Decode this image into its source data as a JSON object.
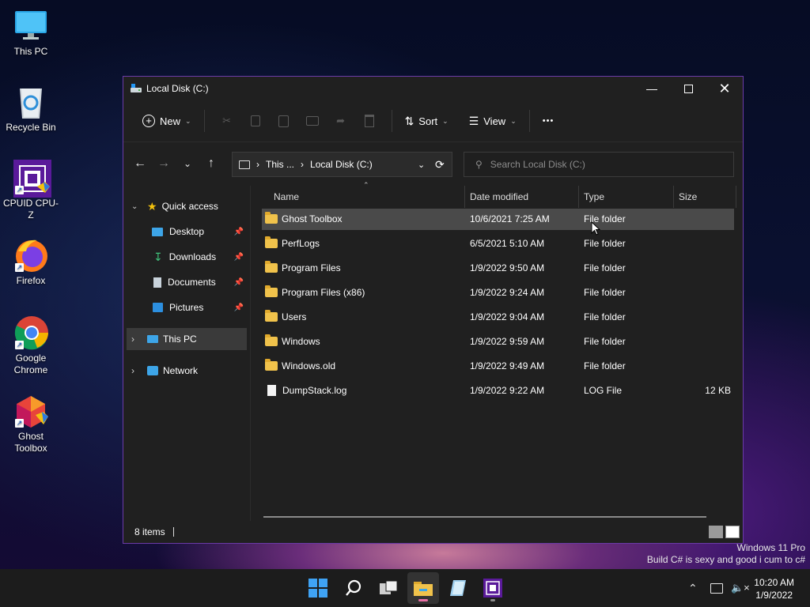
{
  "desktop": {
    "icons": [
      {
        "label": "This PC"
      },
      {
        "label": "Recycle Bin"
      },
      {
        "label": "CPUID CPU-Z"
      },
      {
        "label": "Firefox"
      },
      {
        "label": "Google Chrome"
      },
      {
        "label": "Ghost Toolbox"
      }
    ],
    "watermark_line1": "Windows 11 Pro",
    "watermark_line2": "Build C# is sexy and good i cum to c#"
  },
  "window": {
    "title": "Local Disk (C:)",
    "commands": {
      "new_label": "New",
      "sort_label": "Sort",
      "view_label": "View",
      "more_label": "•••"
    },
    "breadcrumb": {
      "part1": "This ...",
      "part2": "Local Disk (C:)"
    },
    "search_placeholder": "Search Local Disk (C:)",
    "nav": {
      "quick_access": "Quick access",
      "desktop": "Desktop",
      "downloads": "Downloads",
      "documents": "Documents",
      "pictures": "Pictures",
      "this_pc": "This PC",
      "network": "Network"
    },
    "columns": {
      "name": "Name",
      "date": "Date modified",
      "type": "Type",
      "size": "Size"
    },
    "rows": [
      {
        "name": "Ghost Toolbox",
        "date": "10/6/2021 7:25 AM",
        "type": "File folder",
        "size": ""
      },
      {
        "name": "PerfLogs",
        "date": "6/5/2021 5:10 AM",
        "type": "File folder",
        "size": ""
      },
      {
        "name": "Program Files",
        "date": "1/9/2022 9:50 AM",
        "type": "File folder",
        "size": ""
      },
      {
        "name": "Program Files (x86)",
        "date": "1/9/2022 9:24 AM",
        "type": "File folder",
        "size": ""
      },
      {
        "name": "Users",
        "date": "1/9/2022 9:04 AM",
        "type": "File folder",
        "size": ""
      },
      {
        "name": "Windows",
        "date": "1/9/2022 9:59 AM",
        "type": "File folder",
        "size": ""
      },
      {
        "name": "Windows.old",
        "date": "1/9/2022 9:49 AM",
        "type": "File folder",
        "size": ""
      },
      {
        "name": "DumpStack.log",
        "date": "1/9/2022 9:22 AM",
        "type": "LOG File",
        "size": "12 KB"
      }
    ],
    "status_items": "8 items"
  },
  "taskbar": {
    "time": "10:20 AM",
    "date": "1/9/2022"
  }
}
